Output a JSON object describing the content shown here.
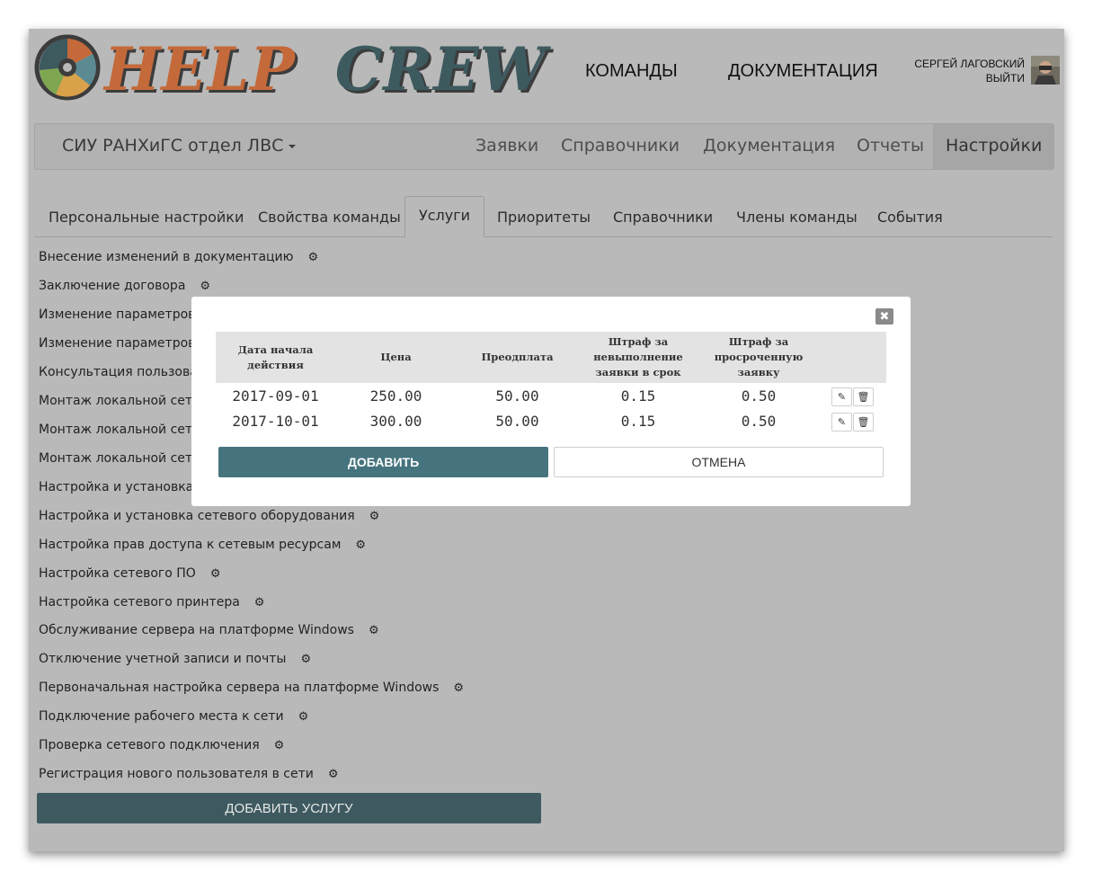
{
  "header": {
    "logo_part1": "HELP",
    "logo_part2": "CREW",
    "nav": [
      "КОМАНДЫ",
      "ДОКУМЕНТАЦИЯ"
    ],
    "user_name": "СЕРГЕЙ ЛАГОВСКИЙ",
    "logout": "ВЫЙТИ"
  },
  "navbar": {
    "brand": "СИУ РАНХиГС отдел ЛВС",
    "links": [
      "Заявки",
      "Справочники",
      "Документация",
      "Отчеты",
      "Настройки"
    ],
    "active": "Настройки"
  },
  "tabs": {
    "items": [
      "Персональные настройки",
      "Свойства команды",
      "Услуги",
      "Приоритеты",
      "Справочники",
      "Члены команды",
      "События"
    ],
    "active": "Услуги"
  },
  "services": [
    "Внесение изменений в документацию",
    "Заключение договора",
    "Изменение параметров д",
    "Изменение параметров п",
    "Консультация пользовате",
    "Монтаж локальной сети н",
    "Монтаж локальной сети н",
    "Монтаж локальной сети с",
    "Настройка и установка се",
    "Настройка и установка сетевого оборудования",
    "Настройка прав доступа к сетевым ресурсам",
    "Настройка сетевого ПО",
    "Настройка сетевого принтера",
    "Обслуживание сервера на платформе Windows",
    "Отключение учетной записи и почты",
    "Первоначальная настройка сервера на платформе Windows",
    "Подключение рабочего места к сети",
    "Проверка сетевого подключения",
    "Регистрация нового пользователя в сети"
  ],
  "add_service_label": "ДОБАВИТЬ УСЛУГУ",
  "modal": {
    "columns": [
      "Дата начала действия",
      "Цена",
      "Преодплата",
      "Штраф за невыполнение заявки в срок",
      "Штраф за просроченную заявку"
    ],
    "rows": [
      {
        "date": "2017-09-01",
        "price": "250.00",
        "prepay": "50.00",
        "fine_fail": "0.15",
        "fine_late": "0.50"
      },
      {
        "date": "2017-10-01",
        "price": "300.00",
        "prepay": "50.00",
        "fine_fail": "0.15",
        "fine_late": "0.50"
      }
    ],
    "add_label": "ДОБАВИТЬ",
    "cancel_label": "ОТМЕНА"
  },
  "icons": {
    "gear": "gear-icon",
    "edit": "pencil-icon",
    "delete": "trash-icon",
    "close": "close-icon",
    "caret": "caret-down-icon"
  },
  "colors": {
    "primary": "#46747e",
    "primary_dark": "#3e5a60",
    "logo_orange": "#c46a3a",
    "logo_teal": "#3d5a5f",
    "overlay": "#b9b9b9"
  }
}
